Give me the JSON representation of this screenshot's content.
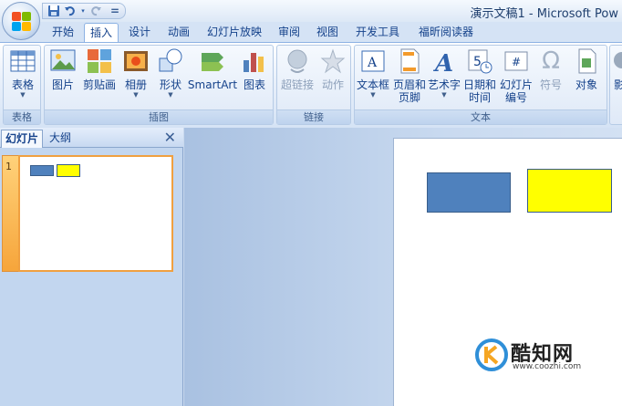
{
  "window": {
    "title": "演示文稿1 - Microsoft Pow"
  },
  "quick_access": {
    "customize_glyph": "="
  },
  "tabs": [
    {
      "label": "开始"
    },
    {
      "label": "插入",
      "active": true
    },
    {
      "label": "设计"
    },
    {
      "label": "动画"
    },
    {
      "label": "幻灯片放映"
    },
    {
      "label": "审阅"
    },
    {
      "label": "视图"
    },
    {
      "label": "开发工具"
    },
    {
      "label": "福昕阅读器"
    }
  ],
  "ribbon": {
    "groups": {
      "tables": {
        "label": "表格",
        "buttons": {
          "table": "表格"
        }
      },
      "illustrations": {
        "label": "插图",
        "buttons": {
          "picture": "图片",
          "clipart": "剪贴画",
          "album": "相册",
          "shapes": "形状",
          "smartart": "SmartArt",
          "chart": "图表"
        }
      },
      "links": {
        "label": "链接",
        "buttons": {
          "hyperlink": "超链接",
          "action": "动作"
        }
      },
      "text": {
        "label": "文本",
        "buttons": {
          "textbox": "文本框",
          "header_footer_1": "页眉和",
          "header_footer_2": "页脚",
          "wordart": "艺术字",
          "datetime_1": "日期和",
          "datetime_2": "时间",
          "slidenum_1": "幻灯片",
          "slidenum_2": "编号",
          "symbol": "符号",
          "object": "对象"
        }
      },
      "media": {
        "partial_label": "影"
      }
    },
    "icons": {
      "datetime_glyph": "5",
      "slidenum_glyph": "#",
      "symbol_glyph": "Ω",
      "wordart_glyph": "A",
      "textbox_glyph": "A"
    }
  },
  "slide_pane": {
    "tabs": {
      "slides": "幻灯片",
      "outline": "大纲"
    },
    "close_glyph": "✕",
    "slide_number": "1"
  },
  "colors": {
    "shape_blue": "#4f81bd",
    "shape_yellow": "#ffff00",
    "shape_border": "#385d8a"
  },
  "watermark": {
    "title": "酷知网",
    "url": "www.coozhi.com"
  }
}
